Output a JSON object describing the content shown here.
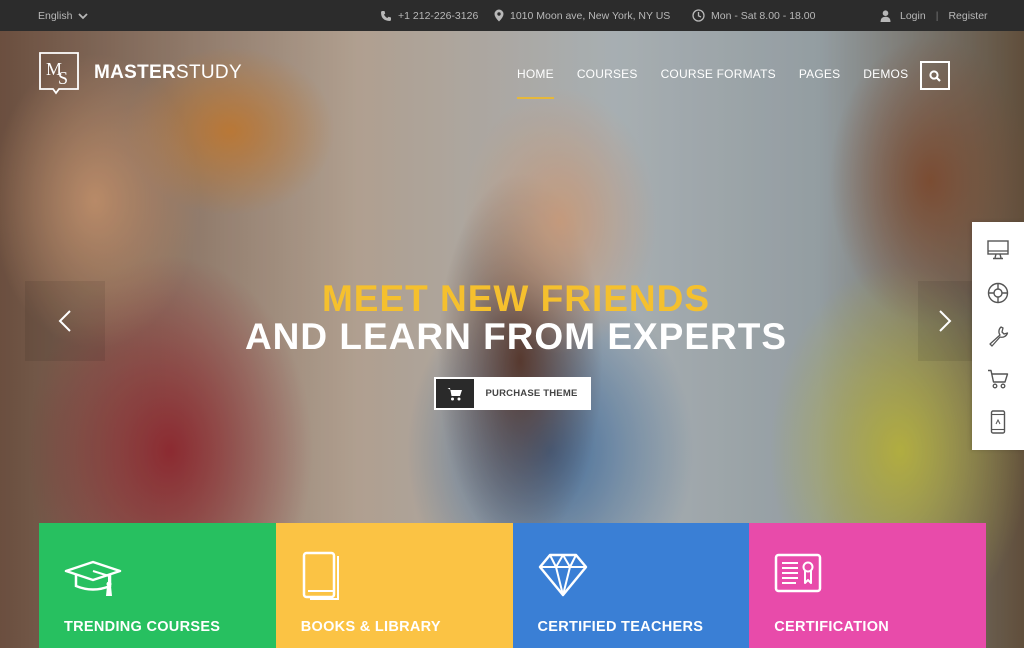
{
  "topbar": {
    "language": "English",
    "phone": "+1 212-226-3126",
    "address": "1010 Moon ave, New York, NY US",
    "hours": "Mon - Sat 8.00 - 18.00",
    "login": "Login",
    "separator": "|",
    "register": "Register"
  },
  "brand": {
    "mark": "MS",
    "name_bold": "MASTER",
    "name_light": "STUDY"
  },
  "nav": {
    "items": [
      {
        "label": "HOME",
        "active": true
      },
      {
        "label": "COURSES",
        "active": false
      },
      {
        "label": "COURSE FORMATS",
        "active": false
      },
      {
        "label": "PAGES",
        "active": false
      },
      {
        "label": "DEMOS",
        "active": false
      }
    ]
  },
  "hero": {
    "line1": "MEET NEW FRIENDS",
    "line2": "AND LEARN FROM EXPERTS",
    "cta_label": "PURCHASE THEME"
  },
  "side_panel": {
    "icons": [
      "monitor-icon",
      "lifebuoy-icon",
      "wrench-icon",
      "cart-icon",
      "mobile-icon"
    ]
  },
  "features": [
    {
      "title": "TRENDING COURSES",
      "color": "#27c060",
      "icon": "graduation-cap-icon"
    },
    {
      "title": "BOOKS & LIBRARY",
      "color": "#fbc344",
      "icon": "book-icon"
    },
    {
      "title": "CERTIFIED TEACHERS",
      "color": "#3a7fd5",
      "icon": "diamond-icon"
    },
    {
      "title": "CERTIFICATION",
      "color": "#e84baa",
      "icon": "certificate-icon"
    }
  ],
  "colors": {
    "accent": "#f5c02e",
    "topbar_bg": "#2c2c2c"
  }
}
